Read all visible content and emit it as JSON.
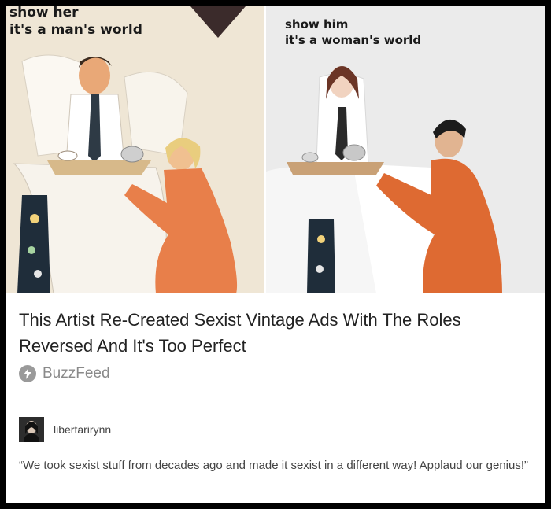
{
  "post": {
    "images": {
      "left": {
        "caption_line1": "show her",
        "caption_line2": "it's a man's world"
      },
      "right": {
        "caption_line1": "show him",
        "caption_line2": "it's a woman's world"
      }
    },
    "headline": "This Artist Re-Created Sexist Vintage Ads With The Roles Reversed And It's Too Perfect",
    "source": {
      "name": "BuzzFeed",
      "icon": "bolt-icon"
    }
  },
  "reblog": {
    "username": "libertarirynn",
    "comment": "“We took sexist stuff from decades ago and made it sexist in a different way! Applaud our genius!”"
  }
}
